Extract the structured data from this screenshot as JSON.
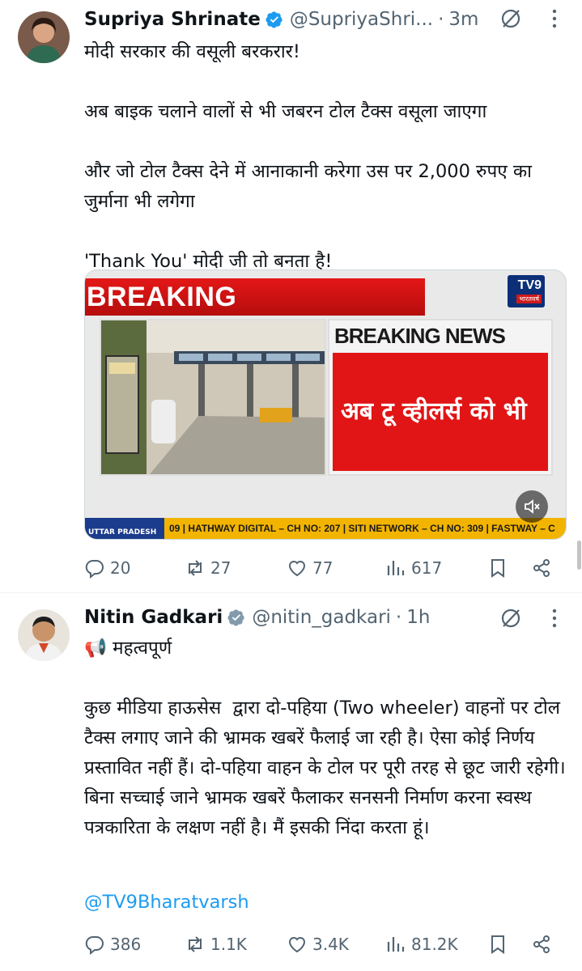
{
  "tweets": [
    {
      "name": "Supriya Shrinate",
      "handle": "@SupriyaShri...",
      "separator": "·",
      "time": "3m",
      "body": "मोदी सरकार की वसूली बरकरार!\n\nअब बाइक चलाने वालों से भी जबरन टोल टैक्स वसूला जाएगा\n\nऔर जो टोल टैक्स देने में आनाकानी करेगा उस पर 2,000 रुपए का जुर्माना भी लगेगा\n\n'Thank You' मोदी जी तो बनता है!",
      "media": {
        "breaking_label": "BREAKING",
        "channel_logo": "TV9",
        "channel_sub": "भारतवर्ष",
        "panel_title": "BREAKING NEWS",
        "panel_headline": "अब टू व्हीलर्स को भी",
        "ticker_badge": "UTTAR PRADESH",
        "ticker_text": "09  |  HATHWAY DIGITAL – CH NO: 207  |  SITI NETWORK – CH NO: 309  |  FASTWAY – C"
      },
      "stats": {
        "replies": "20",
        "reposts": "27",
        "likes": "77",
        "views": "617"
      }
    },
    {
      "name": "Nitin Gadkari",
      "handle": "@nitin_gadkari",
      "separator": "·",
      "time": "1h",
      "body": "📢 महत्वपूर्ण\n\nकुछ मीडिया हाऊसेस  द्वारा दो-पहिया (Two wheeler) वाहनों पर टोल टैक्स लगाए जाने की भ्रामक खबरें फैलाई जा रही है। ऐसा कोई निर्णय प्रस्तावित नहीं हैं। दो-पहिया वाहन के टोल पर पूरी तरह से छूट जारी रहेगी। बिना सच्चाई जाने भ्रामक खबरें फैलाकर सनसनी निर्माण करना स्वस्थ पत्रकारिता के लक्षण नहीं है। मैं इसकी निंदा करता हूं।",
      "mention": "@TV9Bharatvarsh",
      "stats": {
        "replies": "386",
        "reposts": "1.1K",
        "likes": "3.4K",
        "views": "81.2K"
      }
    }
  ],
  "colors": {
    "text": "#0f1419",
    "secondary": "#536471",
    "link": "#1d9bf0",
    "verified": "#1d9bf0",
    "verified_gov": "#829aab",
    "breaking_red": "#e11515"
  },
  "icons": [
    "verified-badge-icon",
    "grok-icon",
    "more-icon",
    "reply-icon",
    "repost-icon",
    "like-icon",
    "views-icon",
    "bookmark-icon",
    "share-icon",
    "mute-icon",
    "megaphone-icon"
  ]
}
